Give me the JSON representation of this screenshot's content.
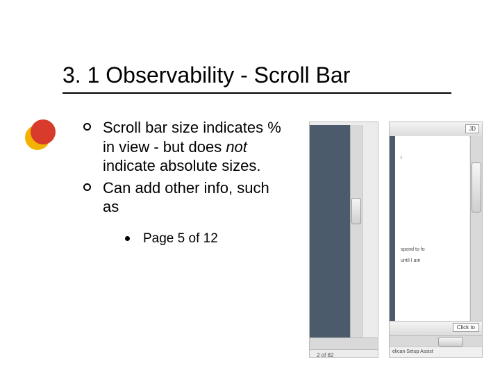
{
  "title": "3. 1 Observability - Scroll Bar",
  "bullets": [
    {
      "pre": "Scroll bar size indicates % in view - but does ",
      "em": "not",
      "post": " indicate absolute sizes."
    },
    {
      "pre": "Can add other info, such as",
      "em": "",
      "post": ""
    }
  ],
  "sub_bullets": [
    "Page 5 of 12"
  ],
  "screenshots": {
    "left": {
      "page_indicator": "2 of 82"
    },
    "right": {
      "tab_label": "JD",
      "snippet1": "i",
      "snippet2": "spond to fo",
      "snippet3": "until I am",
      "button_label": "Click to",
      "status_text": "elican Setup Assist"
    }
  }
}
